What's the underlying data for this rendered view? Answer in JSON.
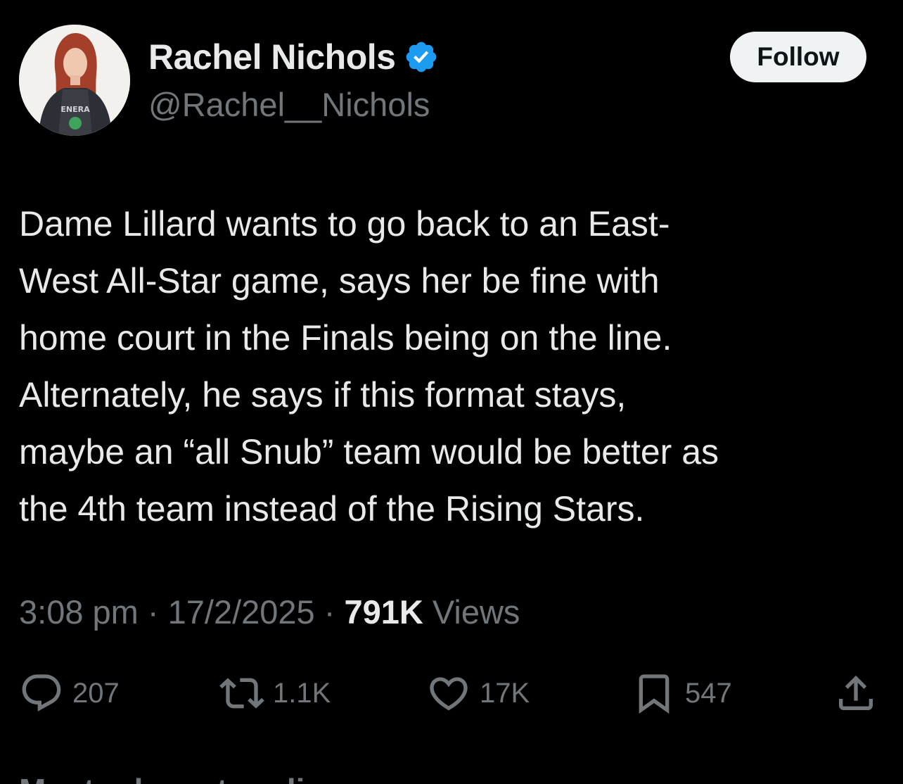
{
  "author": {
    "display_name": "Rachel Nichols",
    "handle": "@Rachel__Nichols",
    "verified": true
  },
  "follow_label": "Follow",
  "tweet": {
    "lines": [
      "Dame Lillard wants to go back to an East-",
      "West All-Star game, says her be fine with",
      "home court in the Finals being on the line.",
      "Alternately, he says if this format stays,",
      "maybe an “all Snub” team would be better as",
      "the 4th team instead of the Rising Stars."
    ]
  },
  "meta": {
    "time": "3:08 pm",
    "separator": " · ",
    "date": "17/2/2025",
    "views_count": "791K",
    "views_label": " Views"
  },
  "actions": {
    "replies": "207",
    "reposts": "1.1K",
    "likes": "17K",
    "bookmarks": "547"
  },
  "next_section_label": "Most relevant replies",
  "colors": {
    "background": "#000000",
    "primary_text": "#e7e9ea",
    "secondary_text": "#71767b",
    "verified_blue": "#1d9bf0",
    "follow_bg": "#eff3f4"
  },
  "icons": [
    "verified-badge-icon",
    "reply-icon",
    "repost-icon",
    "like-icon",
    "bookmark-icon",
    "share-icon"
  ]
}
